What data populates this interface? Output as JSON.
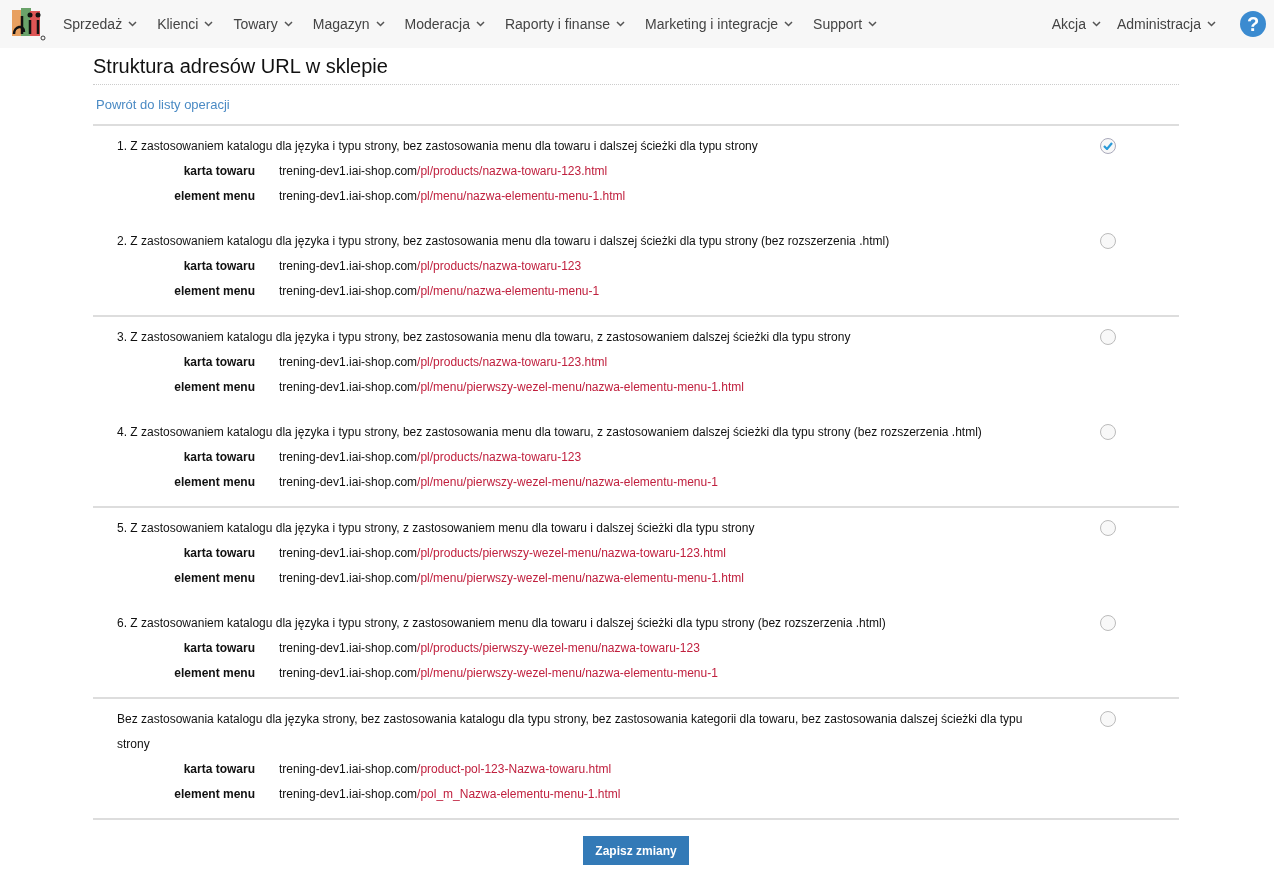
{
  "nav": {
    "items": [
      "Sprzedaż",
      "Klienci",
      "Towary",
      "Magazyn",
      "Moderacja",
      "Raporty i finanse",
      "Marketing i integracje",
      "Support"
    ],
    "right_items": [
      "Akcja",
      "Administracja"
    ],
    "help": "?"
  },
  "title": "Struktura adresów URL w sklepie",
  "back_link": "Powrót do listy operacji",
  "groups": [
    {
      "options": [
        {
          "label": "1. Z zastosowaniem katalogu dla języka i typu strony, bez zastosowania menu dla towaru i dalszej ścieżki dla typu strony",
          "selected": true,
          "rows": [
            {
              "label": "karta towaru",
              "host": "trening-dev1.iai-shop.com",
              "path": "/pl/products/nazwa-towaru-123.html"
            },
            {
              "label": "element menu",
              "host": "trening-dev1.iai-shop.com",
              "path": "/pl/menu/nazwa-elementu-menu-1.html"
            }
          ]
        },
        {
          "label": "2. Z zastosowaniem katalogu dla języka i typu strony, bez zastosowania menu dla towaru i dalszej ścieżki dla typu strony (bez rozszerzenia .html)",
          "selected": false,
          "rows": [
            {
              "label": "karta towaru",
              "host": "trening-dev1.iai-shop.com",
              "path": "/pl/products/nazwa-towaru-123"
            },
            {
              "label": "element menu",
              "host": "trening-dev1.iai-shop.com",
              "path": "/pl/menu/nazwa-elementu-menu-1"
            }
          ]
        }
      ]
    },
    {
      "options": [
        {
          "label": "3. Z zastosowaniem katalogu dla języka i typu strony, bez zastosowania menu dla towaru, z zastosowaniem dalszej ścieżki dla typu strony",
          "selected": false,
          "rows": [
            {
              "label": "karta towaru",
              "host": "trening-dev1.iai-shop.com",
              "path": "/pl/products/nazwa-towaru-123.html"
            },
            {
              "label": "element menu",
              "host": "trening-dev1.iai-shop.com",
              "path": "/pl/menu/pierwszy-wezel-menu/nazwa-elementu-menu-1.html"
            }
          ]
        },
        {
          "label": "4. Z zastosowaniem katalogu dla języka i typu strony, bez zastosowania menu dla towaru, z zastosowaniem dalszej ścieżki dla typu strony (bez rozszerzenia .html)",
          "selected": false,
          "rows": [
            {
              "label": "karta towaru",
              "host": "trening-dev1.iai-shop.com",
              "path": "/pl/products/nazwa-towaru-123"
            },
            {
              "label": "element menu",
              "host": "trening-dev1.iai-shop.com",
              "path": "/pl/menu/pierwszy-wezel-menu/nazwa-elementu-menu-1"
            }
          ]
        }
      ]
    },
    {
      "options": [
        {
          "label": "5. Z zastosowaniem katalogu dla języka i typu strony, z zastosowaniem menu dla towaru i dalszej ścieżki dla typu strony",
          "selected": false,
          "rows": [
            {
              "label": "karta towaru",
              "host": "trening-dev1.iai-shop.com",
              "path": "/pl/products/pierwszy-wezel-menu/nazwa-towaru-123.html"
            },
            {
              "label": "element menu",
              "host": "trening-dev1.iai-shop.com",
              "path": "/pl/menu/pierwszy-wezel-menu/nazwa-elementu-menu-1.html"
            }
          ]
        },
        {
          "label": "6. Z zastosowaniem katalogu dla języka i typu strony, z zastosowaniem menu dla towaru i dalszej ścieżki dla typu strony (bez rozszerzenia .html)",
          "selected": false,
          "rows": [
            {
              "label": "karta towaru",
              "host": "trening-dev1.iai-shop.com",
              "path": "/pl/products/pierwszy-wezel-menu/nazwa-towaru-123"
            },
            {
              "label": "element menu",
              "host": "trening-dev1.iai-shop.com",
              "path": "/pl/menu/pierwszy-wezel-menu/nazwa-elementu-menu-1"
            }
          ]
        }
      ]
    },
    {
      "options": [
        {
          "label": "Bez zastosowania katalogu dla języka strony, bez zastosowania katalogu dla typu strony, bez zastosowania kategorii dla towaru, bez zastosowania dalszej ścieżki dla typu strony",
          "selected": false,
          "rows": [
            {
              "label": "karta towaru",
              "host": "trening-dev1.iai-shop.com",
              "path": "/product-pol-123-Nazwa-towaru.html"
            },
            {
              "label": "element menu",
              "host": "trening-dev1.iai-shop.com",
              "path": "/pol_m_Nazwa-elementu-menu-1.html"
            }
          ]
        }
      ]
    }
  ],
  "save_button": "Zapisz zmiany"
}
